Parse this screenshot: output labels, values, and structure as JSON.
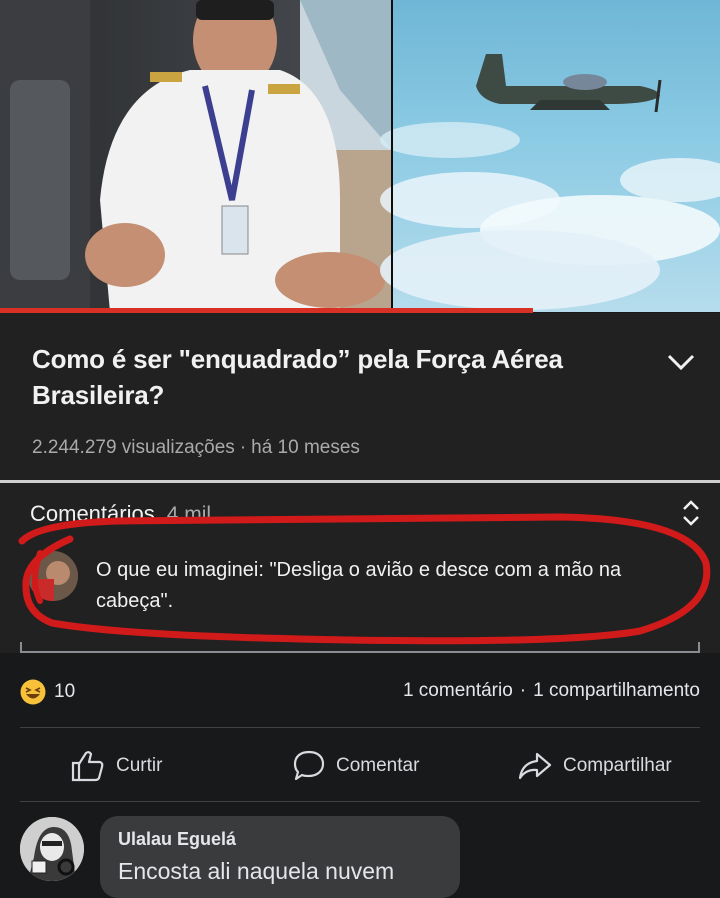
{
  "video": {
    "title": "Como é ser \"enquadrado” pela Força Aérea Brasileira?",
    "views": "2.244.279 visualizações",
    "age": "há 10 meses",
    "progress_fraction": 0.74
  },
  "comments_panel": {
    "heading": "Comentários",
    "count": "4 mil",
    "top_comment": "O que eu imaginei: \"Desliga o avião e desce com a mão na cabeça\"."
  },
  "post": {
    "reaction_count": "10",
    "comments": "1 comentário",
    "shares": "1 compartilhamento",
    "actions": {
      "like": "Curtir",
      "comment": "Comentar",
      "share": "Compartilhar"
    }
  },
  "reply": {
    "author": "Ulalau Eguelá",
    "text": "Encosta ali naquela nuvem"
  },
  "colors": {
    "annotation_red": "#d11a1a",
    "progress_red": "#d93025",
    "fb_dark": "#18191a",
    "bubble": "#3a3b3c"
  }
}
